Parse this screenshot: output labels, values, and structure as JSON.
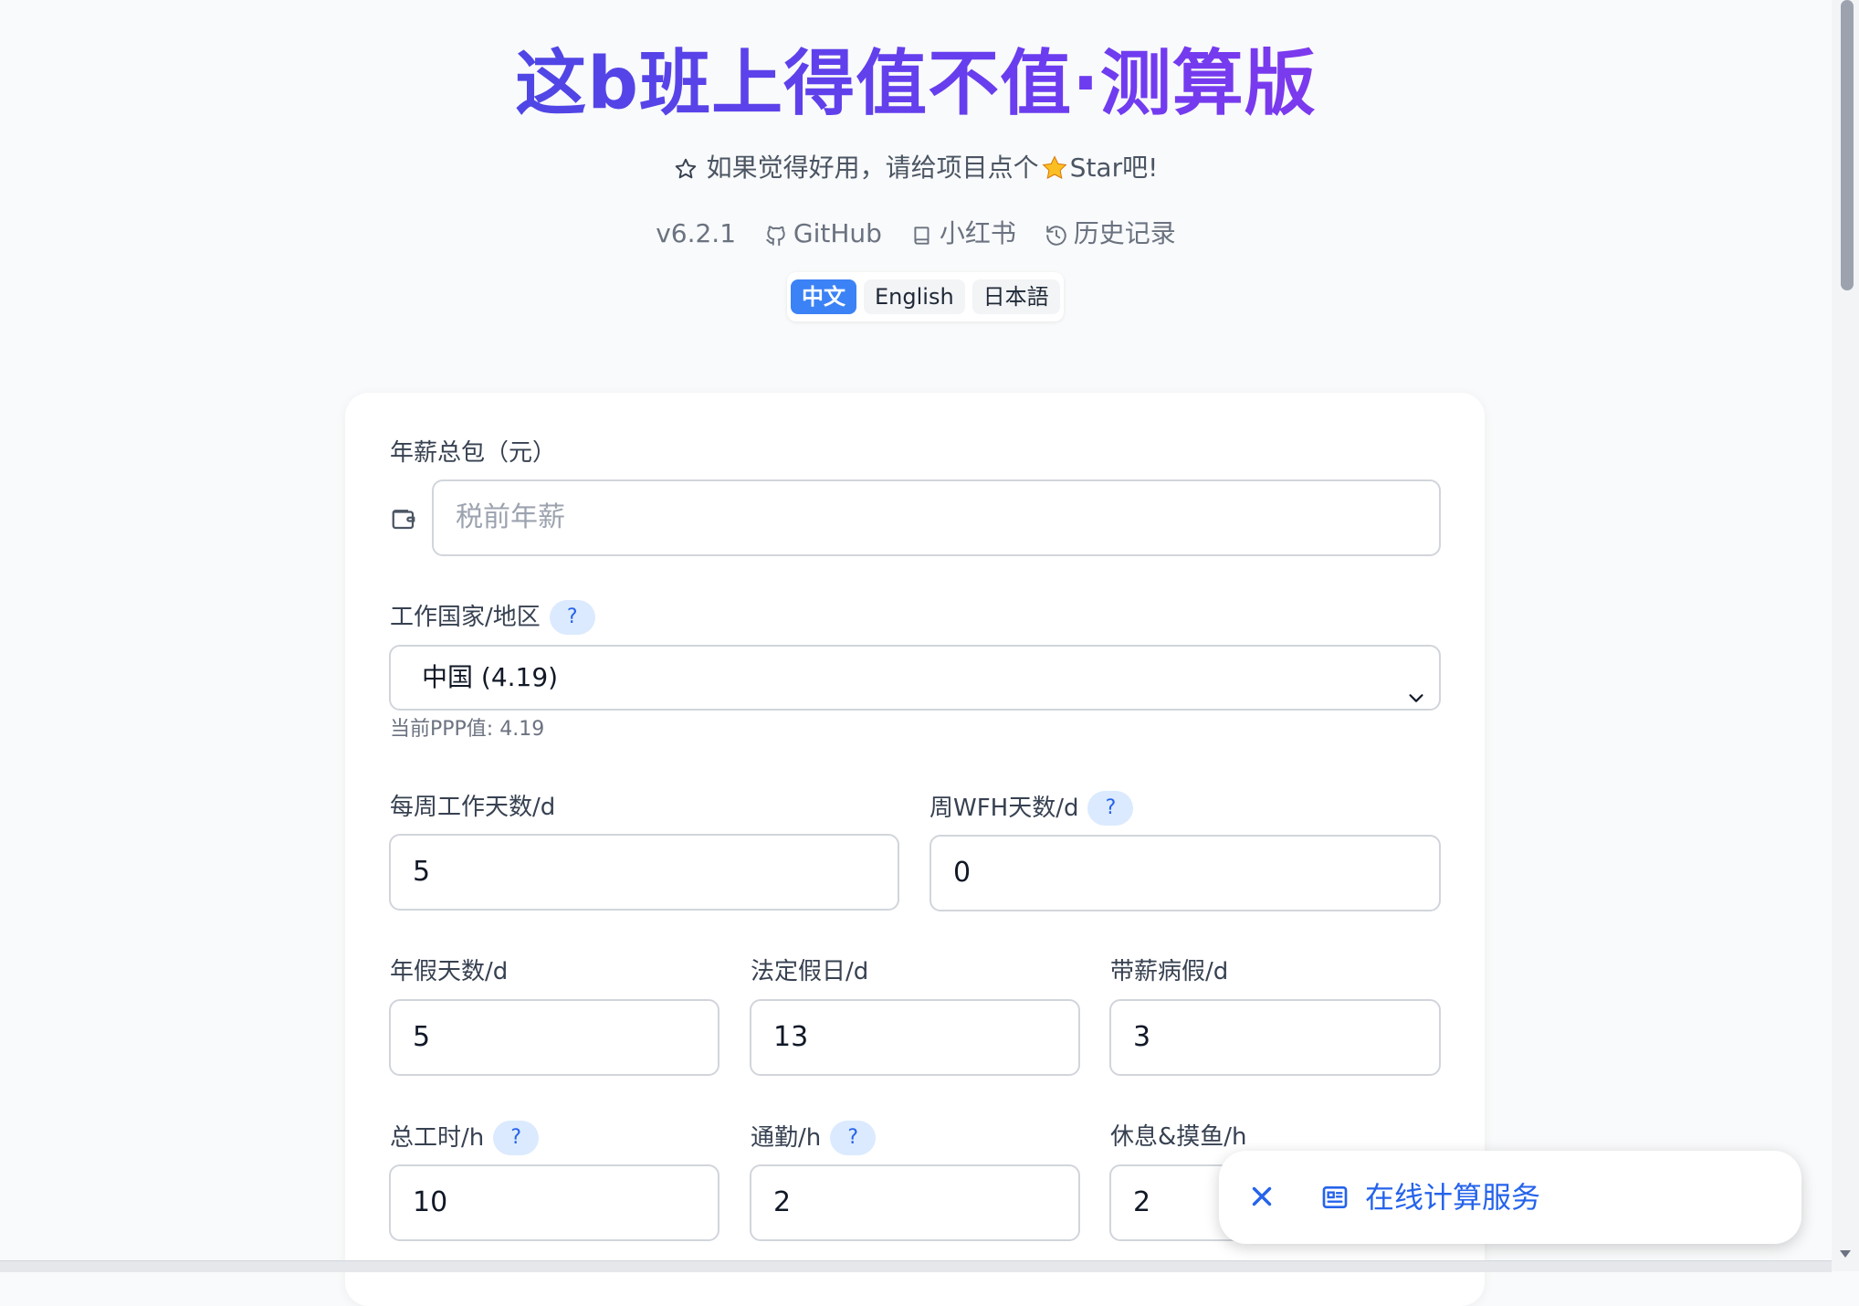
{
  "header": {
    "title": "这b班上得值不值·测算版",
    "star_text": "如果觉得好用，请给项目点个",
    "star_suffix": "Star吧!"
  },
  "links": {
    "version": "v6.2.1",
    "github": "GitHub",
    "xiaohongshu": "小红书",
    "history": "历史记录"
  },
  "languages": [
    {
      "label": "中文",
      "active": true
    },
    {
      "label": "English",
      "active": false
    },
    {
      "label": "日本語",
      "active": false
    }
  ],
  "form": {
    "salary": {
      "label": "年薪总包（元）",
      "placeholder": "税前年薪",
      "value": ""
    },
    "country": {
      "label": "工作国家/地区",
      "help": "?",
      "selected": "中国 (4.19)",
      "ppp_hint": "当前PPP值: 4.19"
    },
    "work_days": {
      "label": "每周工作天数/d",
      "value": "5"
    },
    "wfh_days": {
      "label": "周WFH天数/d",
      "help": "?",
      "value": "0"
    },
    "annual_leave": {
      "label": "年假天数/d",
      "value": "5"
    },
    "public_holidays": {
      "label": "法定假日/d",
      "value": "13"
    },
    "paid_sick": {
      "label": "带薪病假/d",
      "value": "3"
    },
    "total_hours": {
      "label": "总工时/h",
      "help": "?",
      "value": "10"
    },
    "commute": {
      "label": "通勤/h",
      "help": "?",
      "value": "2"
    },
    "rest": {
      "label": "休息&摸鱼/h",
      "value": "2"
    }
  },
  "toast": {
    "label": "在线计算服务"
  },
  "colors": {
    "accent": "#3b82f6",
    "title_gradient_start": "#4f46e5",
    "title_gradient_end": "#7c3aed",
    "help_bg": "#dbeafe"
  }
}
